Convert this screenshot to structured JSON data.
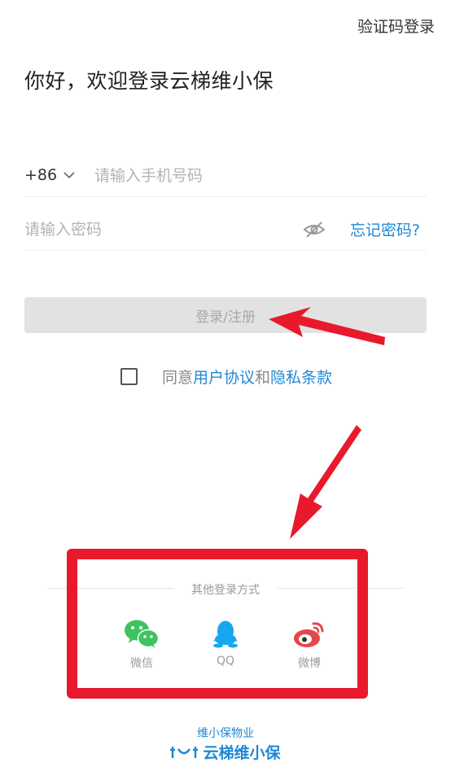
{
  "header": {
    "alt_login_label": "验证码登录"
  },
  "title": "你好，欢迎登录云梯维小保",
  "phone": {
    "country_code": "+86",
    "placeholder": "请输入手机号码"
  },
  "password": {
    "placeholder": "请输入密码",
    "forgot_label": "忘记密码?"
  },
  "login_button_label": "登录/注册",
  "agreement": {
    "prefix": "同意",
    "user_agreement": "用户协议",
    "and": "和",
    "privacy": "隐私条款"
  },
  "other_login": {
    "title": "其他登录方式",
    "options": [
      {
        "label": "微信",
        "icon": "wechat-icon",
        "color": "#3fc35f"
      },
      {
        "label": "QQ",
        "icon": "qq-icon",
        "color": "#17a7f0"
      },
      {
        "label": "微博",
        "icon": "weibo-icon",
        "color": "#e6474a"
      }
    ]
  },
  "footer": {
    "subtitle": "维小保物业",
    "brand": "云梯维小保"
  },
  "colors": {
    "accent": "#1e88d6",
    "annotation_red": "#e8192c",
    "button_disabled": "#e2e2e2"
  }
}
